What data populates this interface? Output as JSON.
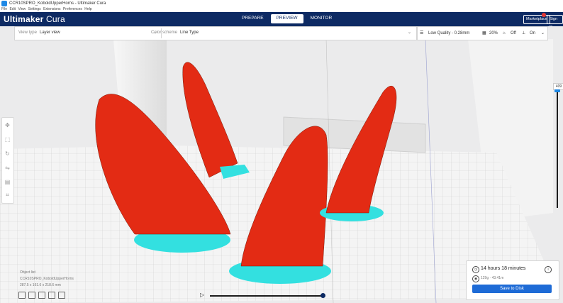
{
  "window": {
    "title": "CCR10SPRO_KoboldUpperHorns - Ultimaker Cura"
  },
  "menu": {
    "items": [
      "File",
      "Edit",
      "View",
      "Settings",
      "Extensions",
      "Preferences",
      "Help"
    ]
  },
  "header": {
    "brand_bold": "Ultimaker",
    "brand_light": "Cura",
    "stages": [
      "PREPARE",
      "PREVIEW",
      "MONITOR"
    ],
    "active_stage": "PREVIEW",
    "marketplace_label": "Marketplace",
    "signin_label": "Sign in",
    "badge_count": "1"
  },
  "toolbar": {
    "view_type_label": "View type",
    "view_type_value": "Layer view",
    "color_scheme_label": "Color scheme",
    "color_scheme_value": "Line Type"
  },
  "print_settings": {
    "profile": "Low Quality - 0.28mm",
    "infill": "20%",
    "support": "Off",
    "adhesion": "On"
  },
  "layer_slider": {
    "current_layer": "409"
  },
  "object_list": {
    "header": "Object list",
    "file_name": "CCR10SPRO_KoboldUpperHorns",
    "dimensions": "287.5 x 161.6 x 218.6 mm"
  },
  "estimate": {
    "time": "14 hours 18 minutes",
    "material": "129g · 43.41m",
    "save_button": "Save to Disk"
  },
  "colors": {
    "header_bg": "#0d2a63",
    "accent": "#1e6bd6",
    "model_fill": "#e32b14",
    "support_fill": "#33e0e0"
  }
}
